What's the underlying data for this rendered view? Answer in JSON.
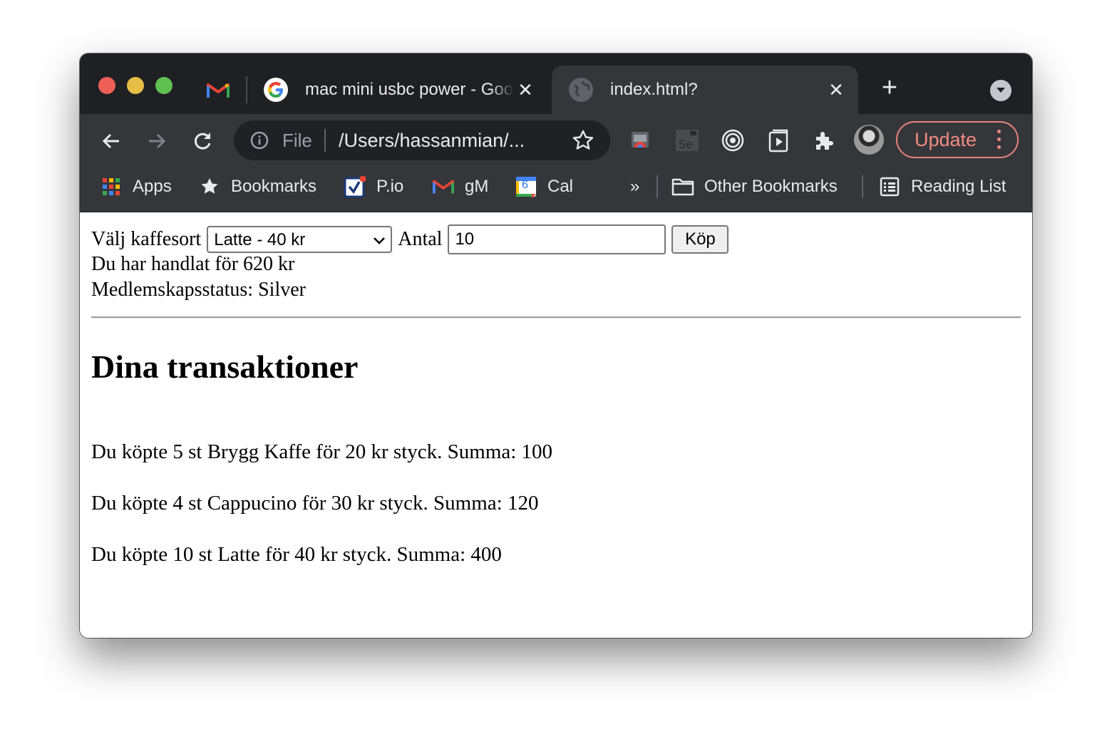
{
  "browser": {
    "pinned_tab": {
      "icon": "gmail-icon"
    },
    "tabs": [
      {
        "title": "mac mini usbc power - Google Search",
        "icon": "google-icon"
      },
      {
        "title": "index.html?",
        "icon": "globe-icon",
        "active": true
      }
    ],
    "omnibox": {
      "scheme_label": "File",
      "url": "/Users/hassanmian/..."
    },
    "update_label": "Update",
    "bookmarks": [
      {
        "label": "Apps",
        "icon": "apps-grid-icon"
      },
      {
        "label": "Bookmarks",
        "icon": "star-icon"
      },
      {
        "label": "P.io",
        "icon": "checkbox-icon"
      },
      {
        "label": "gM",
        "icon": "gmail-icon"
      },
      {
        "label": "Cal",
        "icon": "calendar-icon",
        "badge": "6"
      }
    ],
    "overflow_label": "»",
    "other_bookmarks": "Other Bookmarks",
    "reading_list": "Reading List"
  },
  "page": {
    "coffee_label": "Välj kaffesort",
    "coffee_selected": "Latte - 40 kr",
    "quantity_label": "Antal",
    "quantity_value": "10",
    "buy_label": "Köp",
    "total_text": "Du har handlat för 620 kr",
    "membership_text": "Medlemskapsstatus: Silver",
    "transactions_heading": "Dina transaktioner",
    "transactions": [
      "Du köpte 5 st Brygg Kaffe för 20 kr styck. Summa: 100",
      "Du köpte 4 st Cappucino för 30 kr styck. Summa: 120",
      "Du köpte 10 st Latte för 40 kr styck. Summa: 400"
    ]
  },
  "colors": {
    "tabstrip": "#1f2023",
    "toolbar": "#35363a",
    "update_accent": "#f28b82"
  }
}
